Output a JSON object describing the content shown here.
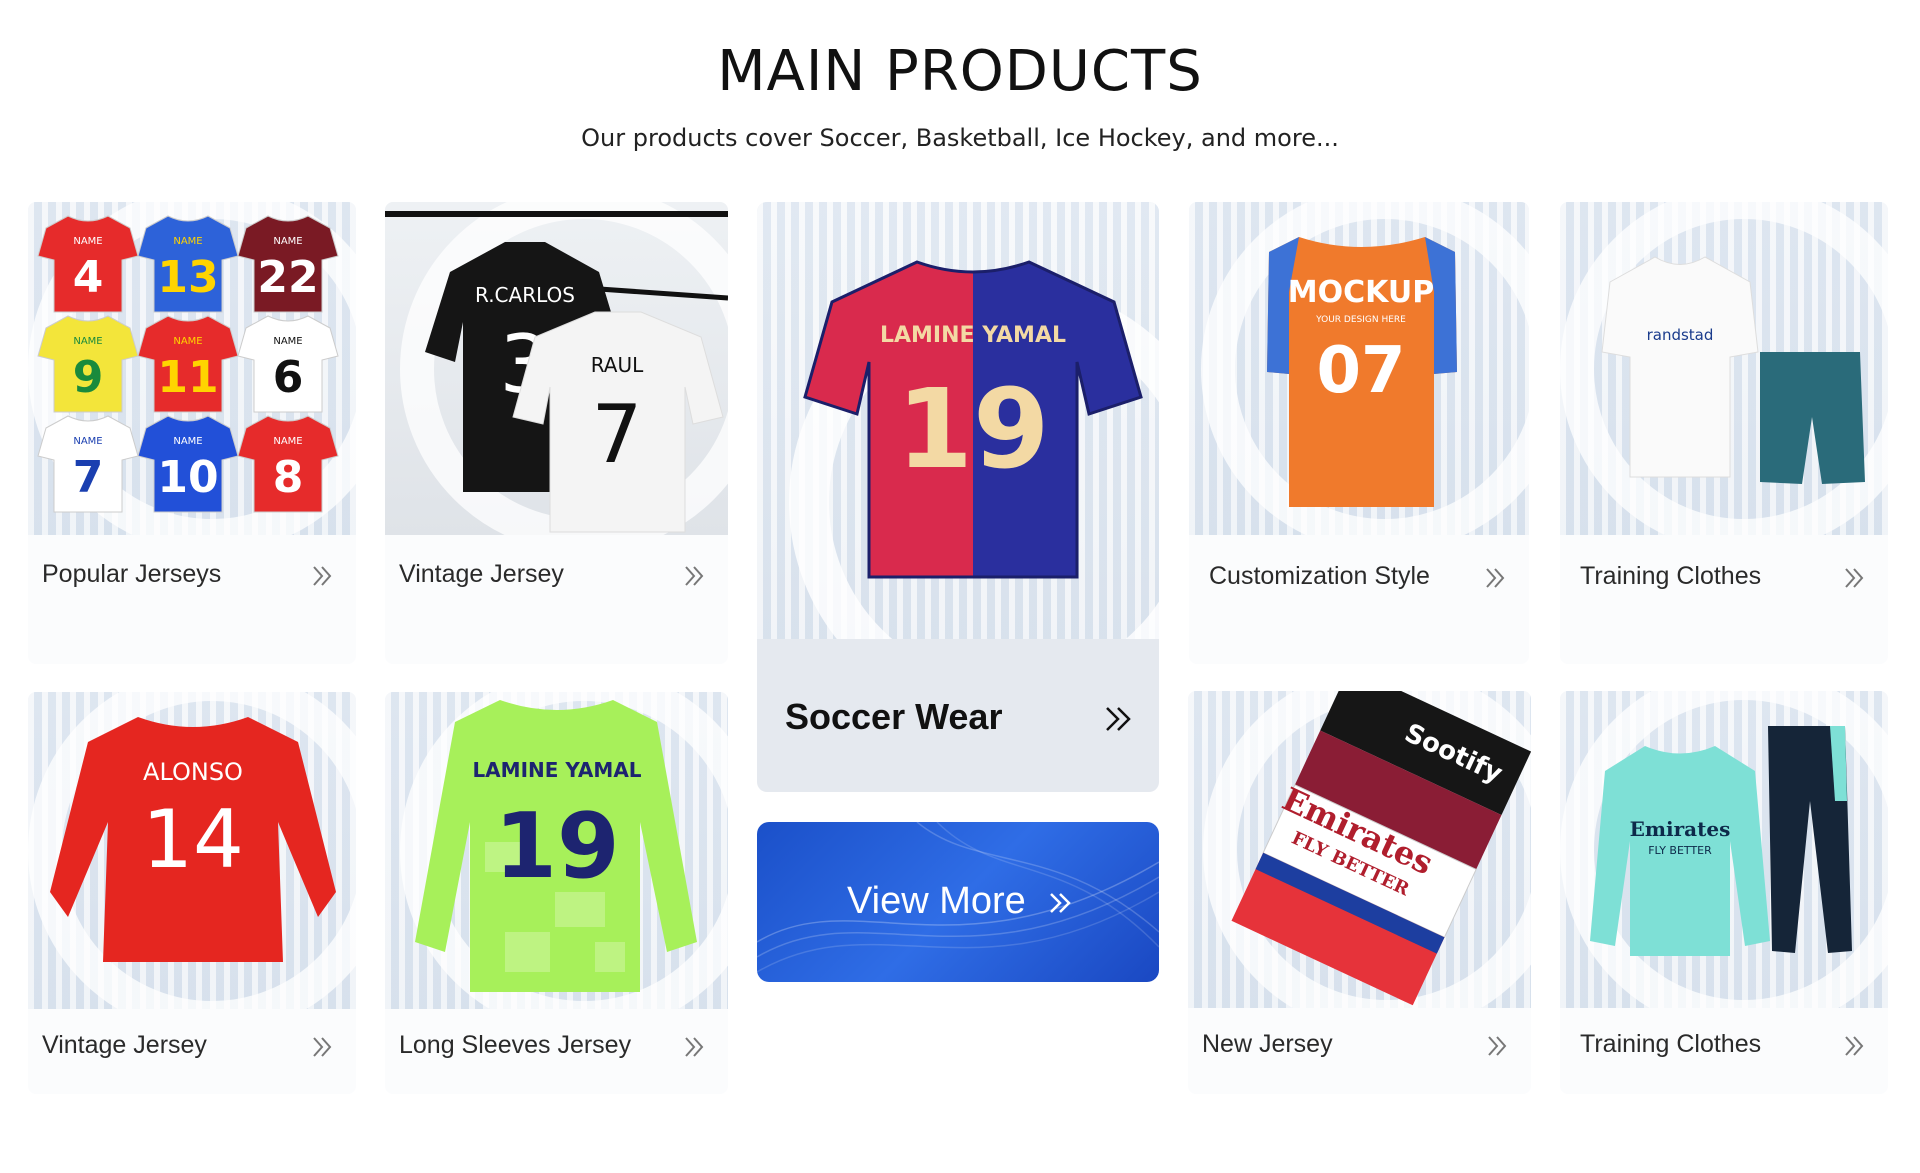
{
  "header": {
    "title": "MAIN PRODUCTS",
    "subtitle": "Our products cover Soccer, Basketball, Ice Hockey, and more..."
  },
  "feature": {
    "label": "Soccer Wear",
    "jersey_name": "LAMINE YAMAL",
    "jersey_number": "19"
  },
  "view_more": {
    "label": "View More"
  },
  "cards": [
    {
      "label": "Popular Jerseys",
      "icon": "jersey-collection-image"
    },
    {
      "label": "Vintage Jersey",
      "icon": "hanging-jerseys-image",
      "names": [
        "R.CARLOS",
        "RAUL"
      ],
      "numbers": [
        "3",
        "7"
      ]
    },
    {
      "label": "Customization Style",
      "icon": "mockup-jersey-image",
      "mockup_text": "MOCKUP",
      "mockup_sub": "YOUR DESIGN HERE",
      "number": "07"
    },
    {
      "label": "Training Clothes",
      "icon": "training-set-image",
      "sponsor": "randstad"
    },
    {
      "label": "Vintage Jersey",
      "icon": "long-sleeve-red-jersey-image",
      "name": "ALONSO",
      "number": "14"
    },
    {
      "label": "Long Sleeves Jersey",
      "icon": "long-sleeve-green-jersey-image",
      "name": "LAMINE YAMAL",
      "number": "19"
    },
    {
      "label": "New Jersey",
      "icon": "folded-jerseys-image",
      "sponsors": [
        "Sootify",
        "Emirates",
        "FLY BETTER"
      ]
    },
    {
      "label": "Training Clothes",
      "icon": "tracksuit-image",
      "sponsor": "Emirates",
      "sponsor_sub": "FLY BETTER"
    }
  ],
  "popular_grid": {
    "name_label": "NAME",
    "numbers": [
      "4",
      "13",
      "22",
      "9",
      "11",
      "6",
      "7",
      "10",
      "8"
    ]
  },
  "colors": {
    "accent_blue": "#2f6de6",
    "card_bg": "#fbfcfd",
    "feature_bg": "#e5e9ef"
  }
}
